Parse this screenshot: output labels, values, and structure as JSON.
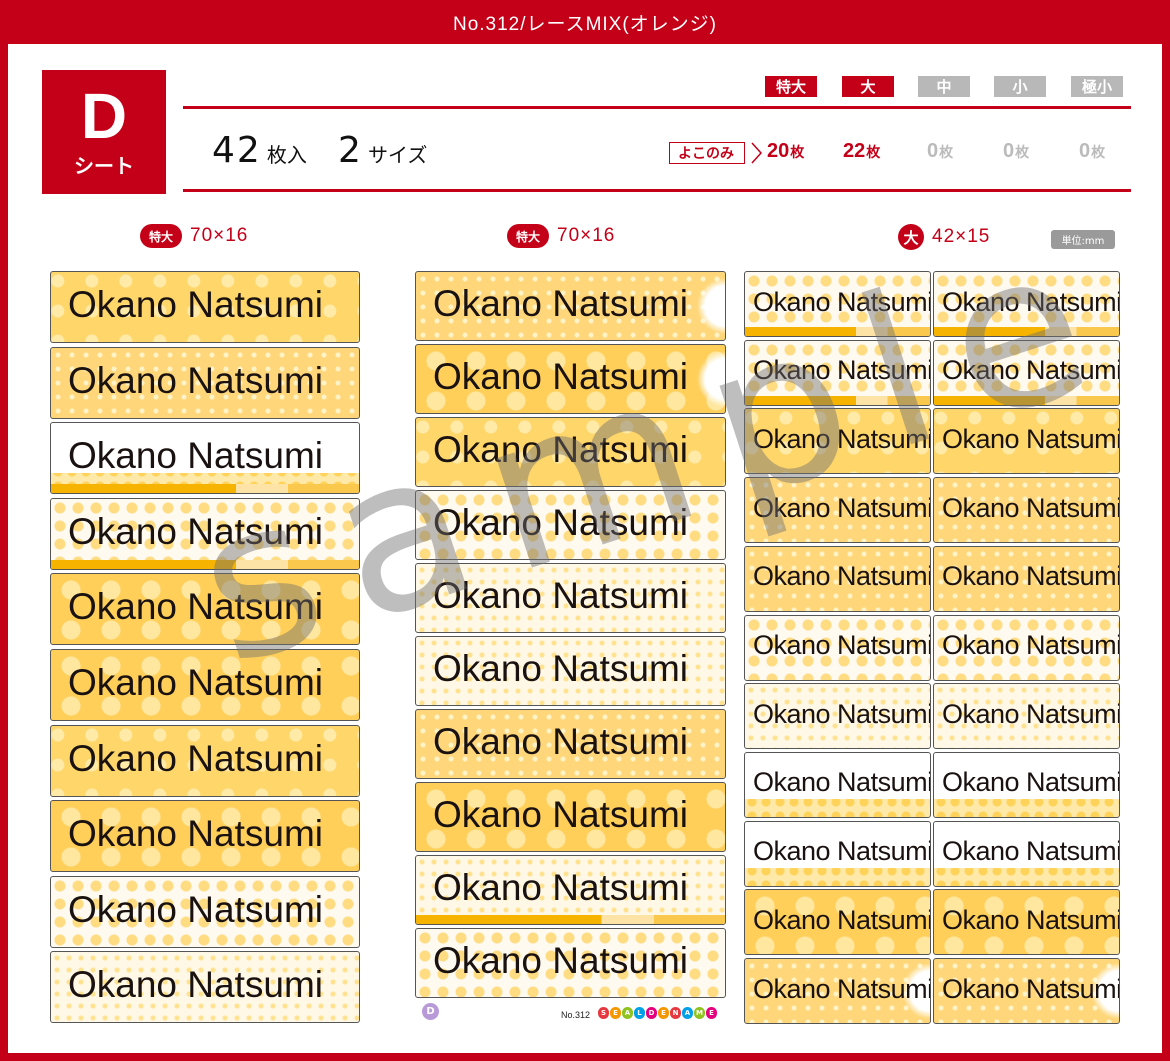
{
  "header": {
    "title": "No.312/レースMIX(オレンジ)"
  },
  "sheet": {
    "letter": "D",
    "sub": "シート",
    "count_num": "42",
    "count_unit": "枚入",
    "size_num": "2",
    "size_unit": "サイズ"
  },
  "sizes": [
    {
      "tag": "特大",
      "count": "20",
      "active": true
    },
    {
      "tag": "大",
      "count": "22",
      "active": true
    },
    {
      "tag": "中",
      "count": "0",
      "active": false
    },
    {
      "tag": "小",
      "count": "0",
      "active": false
    },
    {
      "tag": "極小",
      "count": "0",
      "active": false
    }
  ],
  "sheet_unit": "枚",
  "yoko_label": "よこのみ",
  "columns": [
    {
      "badge": "特大",
      "dims": "70×16"
    },
    {
      "badge": "特大",
      "dims": "70×16"
    },
    {
      "badge": "大",
      "dims": "42×15"
    }
  ],
  "unit_label": "単位:mm",
  "label_text": "Okano Natsumi",
  "watermark": "sample",
  "footer": {
    "badge": "D",
    "number": "No.312",
    "brand_letters": [
      "S",
      "E",
      "A",
      "L",
      "D",
      "E",
      "N",
      "A",
      "M",
      "E"
    ]
  },
  "colors": {
    "accent": "#c40018",
    "label_base": "#ffd66a"
  }
}
